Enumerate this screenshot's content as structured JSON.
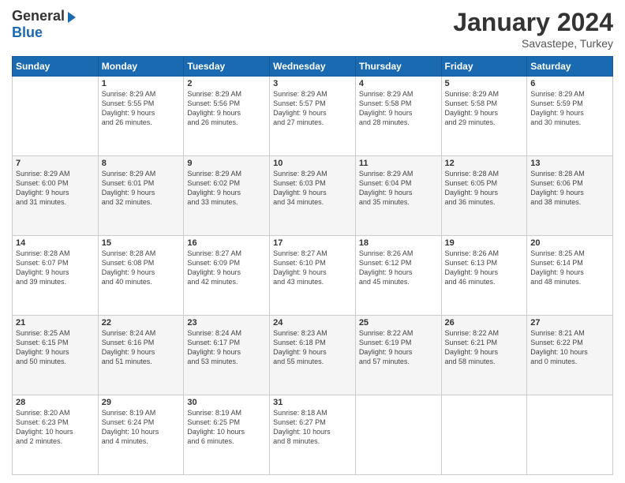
{
  "header": {
    "logo_general": "General",
    "logo_blue": "Blue",
    "month": "January 2024",
    "location": "Savastepe, Turkey"
  },
  "days_of_week": [
    "Sunday",
    "Monday",
    "Tuesday",
    "Wednesday",
    "Thursday",
    "Friday",
    "Saturday"
  ],
  "weeks": [
    [
      {
        "day": "",
        "info": ""
      },
      {
        "day": "1",
        "info": "Sunrise: 8:29 AM\nSunset: 5:55 PM\nDaylight: 9 hours\nand 26 minutes."
      },
      {
        "day": "2",
        "info": "Sunrise: 8:29 AM\nSunset: 5:56 PM\nDaylight: 9 hours\nand 26 minutes."
      },
      {
        "day": "3",
        "info": "Sunrise: 8:29 AM\nSunset: 5:57 PM\nDaylight: 9 hours\nand 27 minutes."
      },
      {
        "day": "4",
        "info": "Sunrise: 8:29 AM\nSunset: 5:58 PM\nDaylight: 9 hours\nand 28 minutes."
      },
      {
        "day": "5",
        "info": "Sunrise: 8:29 AM\nSunset: 5:58 PM\nDaylight: 9 hours\nand 29 minutes."
      },
      {
        "day": "6",
        "info": "Sunrise: 8:29 AM\nSunset: 5:59 PM\nDaylight: 9 hours\nand 30 minutes."
      }
    ],
    [
      {
        "day": "7",
        "info": "Sunrise: 8:29 AM\nSunset: 6:00 PM\nDaylight: 9 hours\nand 31 minutes."
      },
      {
        "day": "8",
        "info": "Sunrise: 8:29 AM\nSunset: 6:01 PM\nDaylight: 9 hours\nand 32 minutes."
      },
      {
        "day": "9",
        "info": "Sunrise: 8:29 AM\nSunset: 6:02 PM\nDaylight: 9 hours\nand 33 minutes."
      },
      {
        "day": "10",
        "info": "Sunrise: 8:29 AM\nSunset: 6:03 PM\nDaylight: 9 hours\nand 34 minutes."
      },
      {
        "day": "11",
        "info": "Sunrise: 8:29 AM\nSunset: 6:04 PM\nDaylight: 9 hours\nand 35 minutes."
      },
      {
        "day": "12",
        "info": "Sunrise: 8:28 AM\nSunset: 6:05 PM\nDaylight: 9 hours\nand 36 minutes."
      },
      {
        "day": "13",
        "info": "Sunrise: 8:28 AM\nSunset: 6:06 PM\nDaylight: 9 hours\nand 38 minutes."
      }
    ],
    [
      {
        "day": "14",
        "info": "Sunrise: 8:28 AM\nSunset: 6:07 PM\nDaylight: 9 hours\nand 39 minutes."
      },
      {
        "day": "15",
        "info": "Sunrise: 8:28 AM\nSunset: 6:08 PM\nDaylight: 9 hours\nand 40 minutes."
      },
      {
        "day": "16",
        "info": "Sunrise: 8:27 AM\nSunset: 6:09 PM\nDaylight: 9 hours\nand 42 minutes."
      },
      {
        "day": "17",
        "info": "Sunrise: 8:27 AM\nSunset: 6:10 PM\nDaylight: 9 hours\nand 43 minutes."
      },
      {
        "day": "18",
        "info": "Sunrise: 8:26 AM\nSunset: 6:12 PM\nDaylight: 9 hours\nand 45 minutes."
      },
      {
        "day": "19",
        "info": "Sunrise: 8:26 AM\nSunset: 6:13 PM\nDaylight: 9 hours\nand 46 minutes."
      },
      {
        "day": "20",
        "info": "Sunrise: 8:25 AM\nSunset: 6:14 PM\nDaylight: 9 hours\nand 48 minutes."
      }
    ],
    [
      {
        "day": "21",
        "info": "Sunrise: 8:25 AM\nSunset: 6:15 PM\nDaylight: 9 hours\nand 50 minutes."
      },
      {
        "day": "22",
        "info": "Sunrise: 8:24 AM\nSunset: 6:16 PM\nDaylight: 9 hours\nand 51 minutes."
      },
      {
        "day": "23",
        "info": "Sunrise: 8:24 AM\nSunset: 6:17 PM\nDaylight: 9 hours\nand 53 minutes."
      },
      {
        "day": "24",
        "info": "Sunrise: 8:23 AM\nSunset: 6:18 PM\nDaylight: 9 hours\nand 55 minutes."
      },
      {
        "day": "25",
        "info": "Sunrise: 8:22 AM\nSunset: 6:19 PM\nDaylight: 9 hours\nand 57 minutes."
      },
      {
        "day": "26",
        "info": "Sunrise: 8:22 AM\nSunset: 6:21 PM\nDaylight: 9 hours\nand 58 minutes."
      },
      {
        "day": "27",
        "info": "Sunrise: 8:21 AM\nSunset: 6:22 PM\nDaylight: 10 hours\nand 0 minutes."
      }
    ],
    [
      {
        "day": "28",
        "info": "Sunrise: 8:20 AM\nSunset: 6:23 PM\nDaylight: 10 hours\nand 2 minutes."
      },
      {
        "day": "29",
        "info": "Sunrise: 8:19 AM\nSunset: 6:24 PM\nDaylight: 10 hours\nand 4 minutes."
      },
      {
        "day": "30",
        "info": "Sunrise: 8:19 AM\nSunset: 6:25 PM\nDaylight: 10 hours\nand 6 minutes."
      },
      {
        "day": "31",
        "info": "Sunrise: 8:18 AM\nSunset: 6:27 PM\nDaylight: 10 hours\nand 8 minutes."
      },
      {
        "day": "",
        "info": ""
      },
      {
        "day": "",
        "info": ""
      },
      {
        "day": "",
        "info": ""
      }
    ]
  ]
}
